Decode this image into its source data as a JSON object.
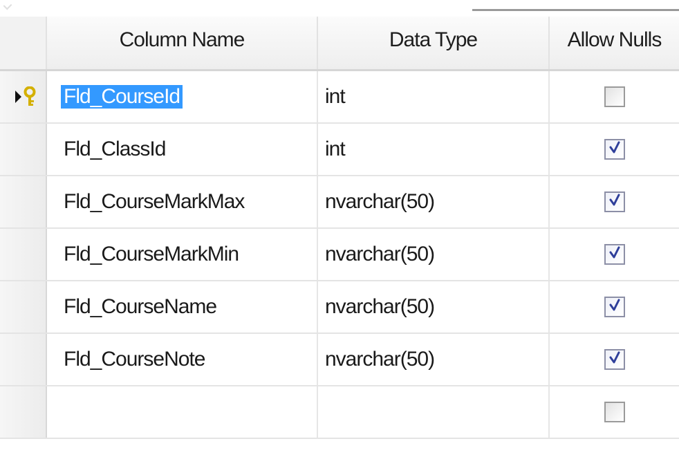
{
  "columns": {
    "name_header": "Column Name",
    "type_header": "Data Type",
    "nulls_header": "Allow Nulls"
  },
  "rows": [
    {
      "name": "Fld_CourseId",
      "type": "int",
      "allow_nulls": false,
      "primary_key": true,
      "selected": true
    },
    {
      "name": "Fld_ClassId",
      "type": "int",
      "allow_nulls": true,
      "primary_key": false,
      "selected": false
    },
    {
      "name": "Fld_CourseMarkMax",
      "type": "nvarchar(50)",
      "allow_nulls": true,
      "primary_key": false,
      "selected": false
    },
    {
      "name": "Fld_CourseMarkMin",
      "type": "nvarchar(50)",
      "allow_nulls": true,
      "primary_key": false,
      "selected": false
    },
    {
      "name": "Fld_CourseName",
      "type": "nvarchar(50)",
      "allow_nulls": true,
      "primary_key": false,
      "selected": false
    },
    {
      "name": "Fld_CourseNote",
      "type": "nvarchar(50)",
      "allow_nulls": true,
      "primary_key": false,
      "selected": false
    },
    {
      "name": "",
      "type": "",
      "allow_nulls": false,
      "primary_key": false,
      "selected": false
    }
  ],
  "icons": {
    "row_pointer": "arrow-right-icon",
    "primary_key": "key-icon",
    "checked": "check-icon"
  },
  "colors": {
    "selection": "#3399ff",
    "key": "#d4b000",
    "check": "#2f3f9a"
  }
}
